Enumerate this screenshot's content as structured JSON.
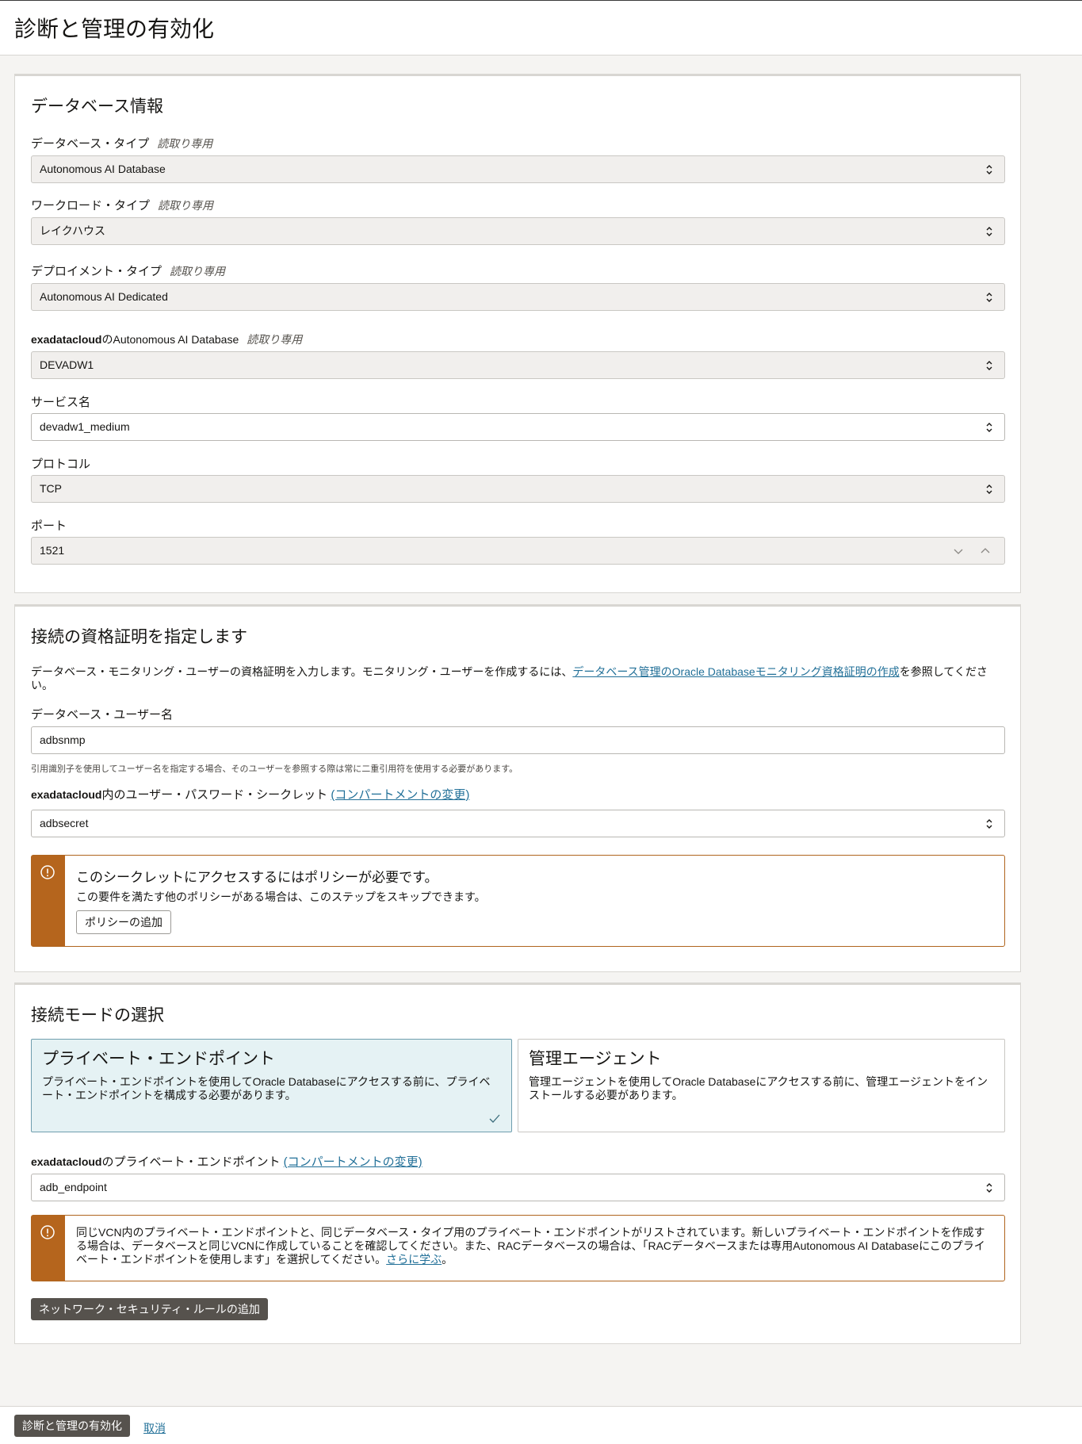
{
  "page": {
    "title": "診断と管理の有効化"
  },
  "db_info": {
    "title": "データベース情報",
    "readonly_label": "読取り専用",
    "db_type": {
      "label": "データベース・タイプ",
      "value": "Autonomous AI Database"
    },
    "workload_type": {
      "label": "ワークロード・タイプ",
      "value": "レイクハウス"
    },
    "deployment_type": {
      "label": "デプロイメント・タイプ",
      "value": "Autonomous AI Dedicated"
    },
    "adb": {
      "label_bold": "exadatacloud",
      "label_rest": "のAutonomous AI Database",
      "value": "DEVADW1"
    },
    "service_name": {
      "label": "サービス名",
      "value": "devadw1_medium"
    },
    "protocol": {
      "label": "プロトコル",
      "value": "TCP"
    },
    "port": {
      "label": "ポート",
      "value": "1521"
    }
  },
  "credentials": {
    "title": "接続の資格証明を指定します",
    "desc_before": "データベース・モニタリング・ユーザーの資格証明を入力します。モニタリング・ユーザーを作成するには、",
    "desc_link": "データベース管理のOracle Databaseモニタリング資格証明の作成",
    "desc_after": "を参照してください。",
    "username": {
      "label": "データベース・ユーザー名",
      "value": "adbsnmp",
      "help": "引用識別子を使用してユーザー名を指定する場合、そのユーザーを参照する際は常に二重引用符を使用する必要があります。"
    },
    "secret": {
      "label_bold": "exadatacloud",
      "label_rest": "内のユーザー・パスワード・シークレット",
      "link": "(コンパートメントの変更)",
      "value": "adbsecret"
    },
    "warning": {
      "title": "このシークレットにアクセスするにはポリシーが必要です。",
      "text": "この要件を満たす他のポリシーがある場合は、このステップをスキップできます。",
      "button": "ポリシーの追加"
    }
  },
  "connection_mode": {
    "title": "接続モードの選択",
    "options": [
      {
        "title": "プライベート・エンドポイント",
        "desc": "プライベート・エンドポイントを使用してOracle Databaseにアクセスする前に、プライベート・エンドポイントを構成する必要があります。"
      },
      {
        "title": "管理エージェント",
        "desc": "管理エージェントを使用してOracle Databaseにアクセスする前に、管理エージェントをインストールする必要があります。"
      }
    ],
    "endpoint": {
      "label_bold": "exadatacloud",
      "label_rest": "のプライベート・エンドポイント",
      "link": "(コンパートメントの変更)",
      "value": "adb_endpoint"
    },
    "info": {
      "text": "同じVCN内のプライベート・エンドポイントと、同じデータベース・タイプ用のプライベート・エンドポイントがリストされています。新しいプライベート・エンドポイントを作成する場合は、データベースと同じVCNに作成していることを確認してください。また、RACデータベースの場合は、「RACデータベースまたは専用Autonomous AI Databaseにこのプライベート・エンドポイントを使用します」を選択してください。",
      "link": "さらに学ぶ",
      "end": "。"
    },
    "add_rules_button": "ネットワーク・セキュリティ・ルールの追加"
  },
  "footer": {
    "submit": "診断と管理の有効化",
    "cancel": "取消"
  },
  "colors": {
    "warning": "#b5651d",
    "link": "#227098",
    "selected_card": "#e5f2f4",
    "primary_button": "#56524d"
  }
}
